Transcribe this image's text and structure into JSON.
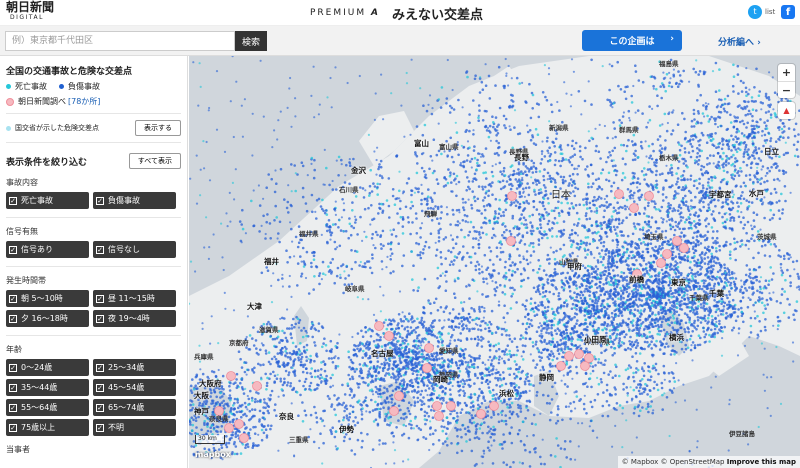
{
  "header": {
    "logo_main": "朝日新聞",
    "logo_sub": "DIGITAL",
    "premium": "PREMIUM",
    "premium_a": "A",
    "title": "みえない交差点",
    "twitter_icon": "twitter-icon",
    "list_label": "list",
    "facebook_icon": "facebook-icon"
  },
  "search": {
    "placeholder": "例）東京都千代田区",
    "button_label": "検索"
  },
  "nav": {
    "project_label": "この企画は",
    "analysis_label": "分析編へ ›"
  },
  "sidebar": {
    "title": "全国の交通事故と危険な交差点",
    "legend": {
      "fatal": "死亡事故",
      "injury": "負傷事故",
      "survey": "朝日新聞調べ",
      "survey_count": "[78か所]"
    },
    "mlit_label": "国交省が示した危険交差点",
    "mlit_button": "表示する",
    "filter_title": "表示条件を絞り込む",
    "show_all_button": "すべて表示",
    "groups": [
      {
        "label": "事故内容",
        "options": [
          "死亡事故",
          "負傷事故"
        ]
      },
      {
        "label": "信号有無",
        "options": [
          "信号あり",
          "信号なし"
        ]
      },
      {
        "label": "発生時間帯",
        "options": [
          "朝 5〜10時",
          "昼 11〜15時",
          "夕 16〜18時",
          "夜 19〜4時"
        ]
      },
      {
        "label": "年齢",
        "options": [
          "0〜24歳",
          "25〜34歳",
          "35〜44歳",
          "45〜54歳",
          "55〜64歳",
          "65〜74歳",
          "75歳以上",
          "不明"
        ]
      }
    ],
    "next_group_label": "当事者"
  },
  "map": {
    "country_label": "日本",
    "prefectures": [
      "福島県",
      "新潟県",
      "群馬県",
      "栃木県",
      "富山県",
      "石川県",
      "長野県",
      "茨城県",
      "飛騨",
      "福井県",
      "埼玉県",
      "山梨県",
      "岐阜県",
      "滋賀県",
      "京都府",
      "愛知県",
      "静岡県",
      "神奈川県",
      "千葉県",
      "三重県",
      "兵庫県",
      "奈良県",
      "伊豆諸島"
    ],
    "cities": [
      "長野",
      "金沢",
      "宇都宮",
      "水戸",
      "前橋",
      "甲府",
      "名古屋",
      "岡崎",
      "浜松",
      "静岡",
      "東京",
      "横浜",
      "千葉",
      "大阪府",
      "大阪",
      "神戸",
      "奈良",
      "伊勢",
      "小田原",
      "日立",
      "富山",
      "福井",
      "大津"
    ],
    "scale_label": "30 km",
    "mapbox_label": "mapbox",
    "attribution": "© Mapbox © OpenStreetMap",
    "improve_label": "Improve this map",
    "zoom_in": "+",
    "zoom_out": "−",
    "compass_icon": "compass-icon"
  }
}
